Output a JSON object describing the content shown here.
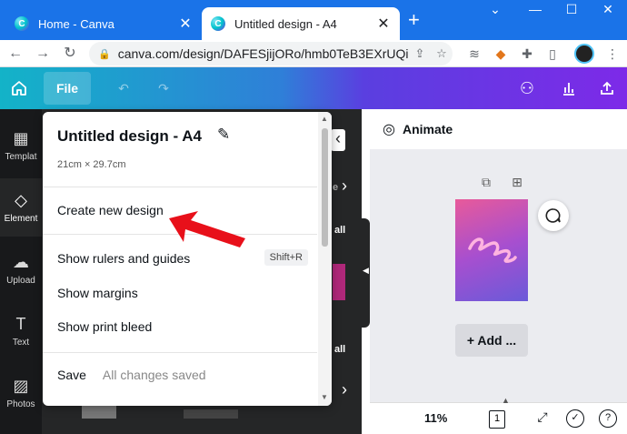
{
  "browser": {
    "tabs": [
      {
        "label": "Home - Canva",
        "close": "✕"
      },
      {
        "label": "Untitled design - A4",
        "close": "✕"
      }
    ],
    "new_tab": "+",
    "window_controls": {
      "chevron": "⌄",
      "minimize": "—",
      "maximize": "☐",
      "close": "✕"
    },
    "url": "canva.com/design/DAFESjijORo/hmb0TeB3EXrUQi..."
  },
  "toolbar": {
    "file_label": "File"
  },
  "rail": {
    "items": [
      {
        "label": "Templat",
        "icon": "template-icon"
      },
      {
        "label": "Element",
        "icon": "elements-icon"
      },
      {
        "label": "Upload",
        "icon": "upload-icon"
      },
      {
        "label": "Text",
        "icon": "text-icon"
      },
      {
        "label": "Photos",
        "icon": "photos-icon"
      }
    ]
  },
  "side_panel": {
    "fragments": [
      "e",
      "all",
      "all"
    ]
  },
  "file_menu": {
    "title": "Untitled design - A4",
    "dimensions": "21cm × 29.7cm",
    "create_new_design": "Create new design",
    "show_rulers": "Show rulers and guides",
    "show_rulers_shortcut": "Shift+R",
    "show_margins": "Show margins",
    "show_print_bleed": "Show print bleed",
    "save": "Save",
    "save_status": "All changes saved"
  },
  "editor": {
    "animate_label": "Animate",
    "add_page_label": "+ Add ...",
    "zoom": "11%",
    "page_count": "1",
    "help": "?"
  },
  "colors": {
    "tabstrip": "#1a73e8",
    "canva_gradient_start": "#13b3c8",
    "canva_gradient_end": "#7d2ae8",
    "annotation_arrow": "#e8101a"
  }
}
